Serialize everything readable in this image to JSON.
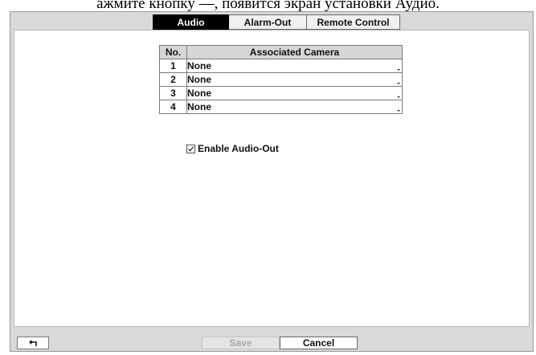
{
  "caption": "ажмите кнопку —, появится экран установки Аудио.",
  "tabs": [
    {
      "label": "Audio",
      "active": true
    },
    {
      "label": "Alarm-Out",
      "active": false
    },
    {
      "label": "Remote Control",
      "active": false
    }
  ],
  "table": {
    "headers": [
      "No.",
      "Associated Camera"
    ],
    "rows": [
      {
        "no": "1",
        "camera": "None"
      },
      {
        "no": "2",
        "camera": "None"
      },
      {
        "no": "3",
        "camera": "None"
      },
      {
        "no": "4",
        "camera": "None"
      }
    ]
  },
  "enable_audio_out": {
    "label": "Enable Audio-Out",
    "checked": true
  },
  "footer": {
    "back_icon": "back-arrow-icon",
    "save_label": "Save",
    "cancel_label": "Cancel"
  },
  "colors": {
    "panel_bg": "#d9d9d9",
    "active_tab": "#000000",
    "disabled_text": "#a8a8a8"
  }
}
